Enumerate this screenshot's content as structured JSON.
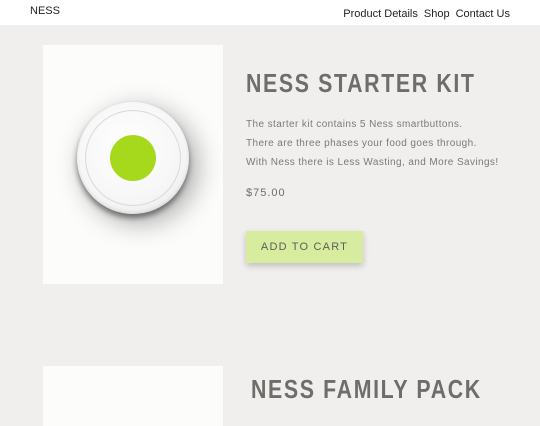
{
  "header": {
    "brand": "NESS",
    "nav": [
      "Product Details",
      "Shop",
      "Contact Us"
    ]
  },
  "products": [
    {
      "title": "NESS STARTER KIT",
      "description": [
        "The starter kit contains 5 Ness smartbuttons.",
        "There are three phases your food goes through.",
        "With Ness there is Less Wasting, and More Savings!"
      ],
      "price": "$75.00",
      "add_to_cart": "ADD TO CART",
      "button_color": "#a6d81c"
    },
    {
      "title": "NESS FAMILY PACK"
    }
  ],
  "colors": {
    "background": "#f0efed",
    "cart_button": "#d8eca0",
    "accent_green": "#a6d81c"
  }
}
